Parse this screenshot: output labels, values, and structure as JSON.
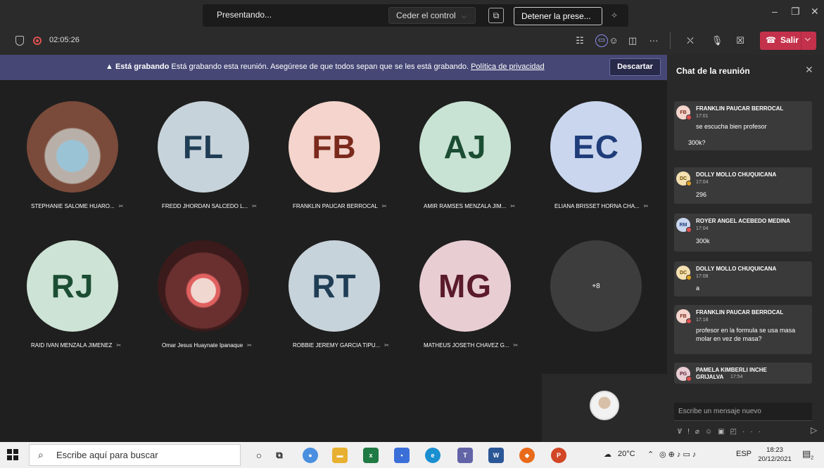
{
  "titlebar": {
    "presenting_label": "Presentando...",
    "give_control_label": "Ceder el control",
    "stop_presenting_label": "Detener la prese...",
    "minimize": "–",
    "maximize": "❐",
    "close": "✕"
  },
  "meeting": {
    "timer": "02:05:26",
    "leave_label": "Salir"
  },
  "banner": {
    "bold": "Está grabando",
    "text": "Está grabando esta reunión. Asegúrese de que todos sepan que se les está grabando.",
    "link": "Política de privacidad",
    "dismiss": "Descartar"
  },
  "participants": [
    {
      "name": "STEPHANIE SALOME HUARO...",
      "initials": "",
      "bg": "#6b4a3c"
    },
    {
      "name": "FREDD JHORDAN SALCEDO L...",
      "initials": "FL",
      "bg": "#c7d3db"
    },
    {
      "name": "FRANKLIN PAUCAR BERROCAL",
      "initials": "FB",
      "bg": "#f4d4cc",
      "color": "#7a2a1c"
    },
    {
      "name": "AMIR RAMSES MENZALA JIM...",
      "initials": "AJ",
      "bg": "#c8e3d3",
      "color": "#1b4d33"
    },
    {
      "name": "ELIANA BRISSET HORNA CHA...",
      "initials": "EC",
      "bg": "#c9d6ee",
      "color": "#1f3d7a"
    },
    {
      "name": "RAID IVAN MENZALA JIMENEZ",
      "initials": "RJ",
      "bg": "#cde3d5",
      "color": "#1b4d33"
    },
    {
      "name": "Omar Jesus Huaynate Ipanaque",
      "initials": "",
      "bg": "#5a2a2a"
    },
    {
      "name": "ROBBIE JEREMY GARCIA TIPU...",
      "initials": "RT",
      "bg": "#c7d3db",
      "color": "#1f3d55"
    },
    {
      "name": "MATHEUS JOSETH CHAVEZ G...",
      "initials": "MG",
      "bg": "#e8cdd3",
      "color": "#5a1a2a"
    }
  ],
  "overflow_count": "+8",
  "chat": {
    "title": "Chat de la reunión",
    "messages": [
      {
        "initials": "FB",
        "sender": "FRANKLIN PAUCAR BERROCAL",
        "time": "17:01",
        "body": "se escucha bien profesor",
        "extra": "300k?",
        "avatar_bg": "#f4d4cc",
        "avatar_fg": "#7a2a1c",
        "status": "#e05050"
      },
      {
        "initials": "DC",
        "sender": "DOLLY MOLLO CHUQUICANA",
        "time": "17:04",
        "body": "296",
        "avatar_bg": "#f4e0b0",
        "avatar_fg": "#6a4a00",
        "status": "#e0a020"
      },
      {
        "initials": "RM",
        "sender": "ROYER ANGEL ACEBEDO MEDINA",
        "time": "17:04",
        "body": "300k",
        "avatar_bg": "#c9d6ee",
        "avatar_fg": "#1f3d7a",
        "status": "#e05050"
      },
      {
        "initials": "DC",
        "sender": "DOLLY MOLLO CHUQUICANA",
        "time": "17:08",
        "body": "a",
        "avatar_bg": "#f4e0b0",
        "avatar_fg": "#6a4a00",
        "status": "#e0a020"
      },
      {
        "initials": "FB",
        "sender": "FRANKLIN PAUCAR BERROCAL",
        "time": "17:18",
        "body": "profesor en la formula se usa masa molar en vez de masa?",
        "avatar_bg": "#f4d4cc",
        "avatar_fg": "#7a2a1c",
        "status": "#e05050"
      },
      {
        "initials": "PG",
        "sender": "PAMELA KIMBERLI INCHE",
        "sender2": "GRIJALVA",
        "time": "17:54",
        "avatar_bg": "#e8cdd3",
        "avatar_fg": "#5a1a2a",
        "status": "#e05050"
      }
    ],
    "input_placeholder": "Escribe un mensaje nuevo"
  },
  "taskbar": {
    "search_placeholder": "Escribe aquí para buscar",
    "weather": "20°C",
    "language": "ESP",
    "time": "18:23",
    "date": "20/12/2021",
    "notif_count": "2"
  }
}
